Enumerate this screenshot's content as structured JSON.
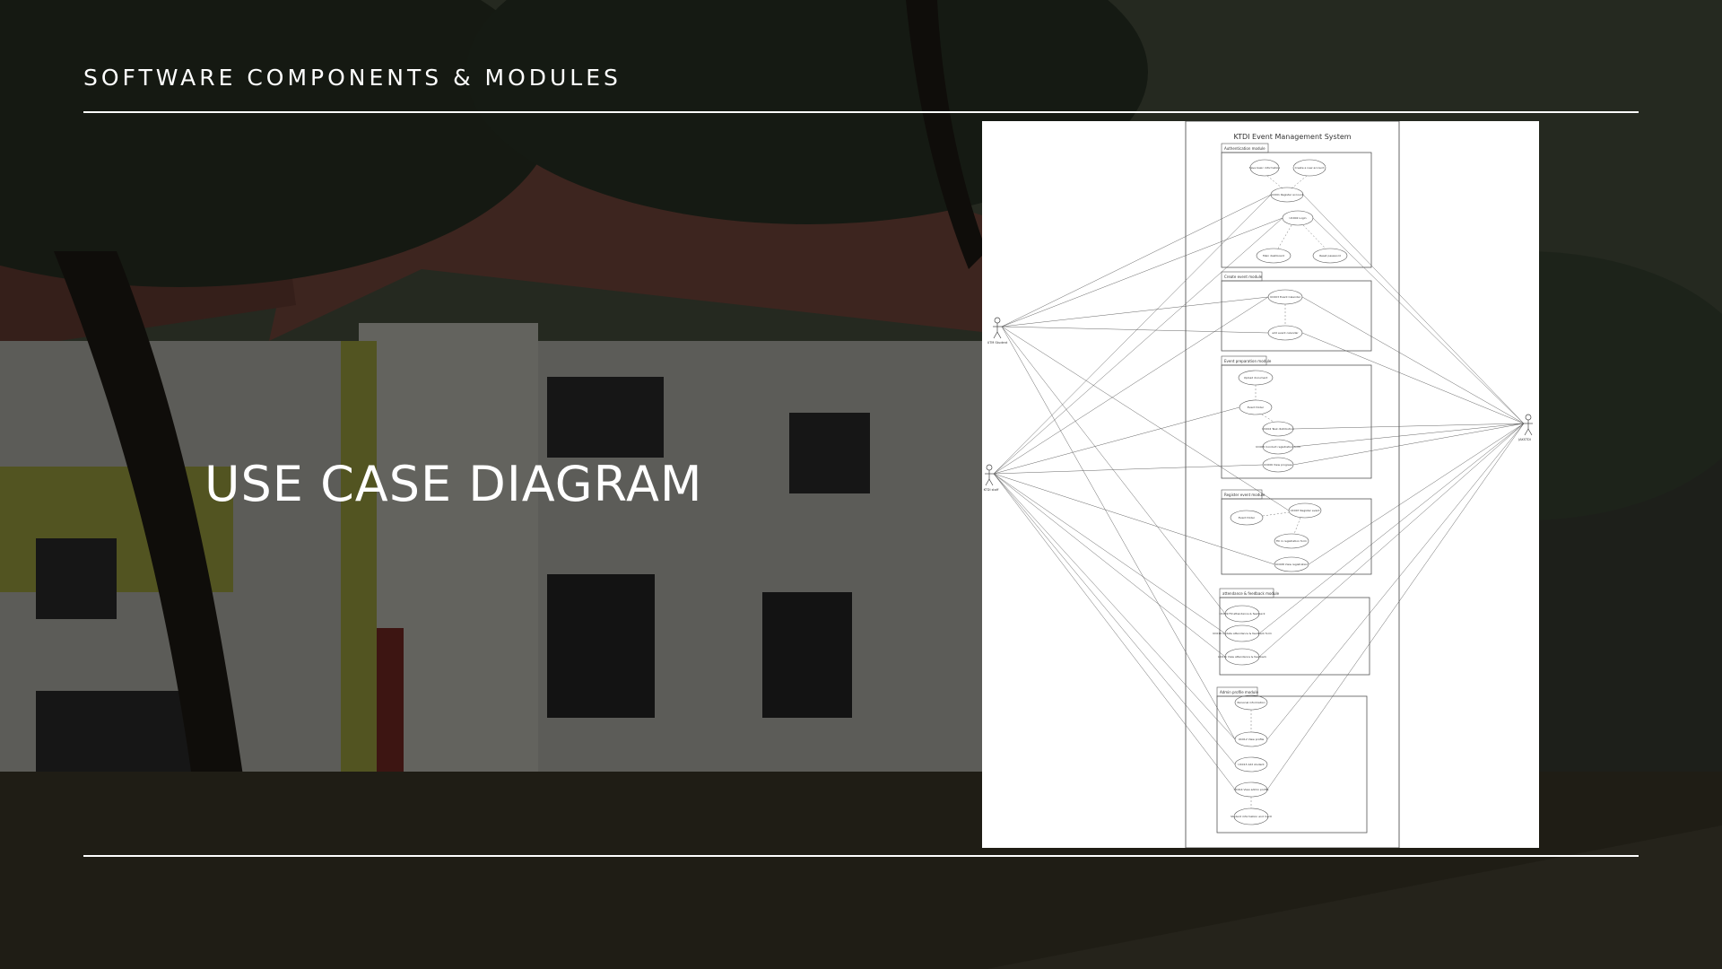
{
  "slide": {
    "section_title": "SOFTWARE COMPONENTS & MODULES",
    "title": "USE CASE DIAGRAM"
  },
  "diagram": {
    "system_title": "KTDI Event Management System",
    "actors": [
      "UTM Student",
      "KTDI staff",
      "JAKSTDI"
    ],
    "modules": [
      {
        "title": "Authentication module",
        "use_cases": [
          "Save basic information",
          "Create a new account",
          "UC001 Register account",
          "UC002 Login",
          "Main dashboard",
          "Reset password"
        ]
      },
      {
        "title": "Create event module",
        "use_cases": [
          "UC003 Event Calendar",
          "add event calendar"
        ]
      },
      {
        "title": "Event preparation module",
        "use_cases": [
          "Upload document",
          "Event folder",
          "UC004 Task distribution",
          "UC005 Conduct registration form",
          "UC006 View progress"
        ]
      },
      {
        "title": "Register event module",
        "use_cases": [
          "Event folder",
          "UC007 Register event",
          "Fill in registration form",
          "UC008 View registration"
        ]
      },
      {
        "title": "attendance & feedback module",
        "use_cases": [
          "UC009 Fill attendance & feedback",
          "UC010 Update attendance & feedback form",
          "UC011 View attendance & feedback"
        ]
      },
      {
        "title": "Admin profile module",
        "use_cases": [
          "Personal information",
          "UC012 View profile",
          "UC013 Add student",
          "UC014 View admin profile",
          "Student information and merit"
        ]
      }
    ]
  },
  "colors": {
    "text": "#ffffff",
    "panel": "#ffffff",
    "diagram_line": "#444444"
  }
}
